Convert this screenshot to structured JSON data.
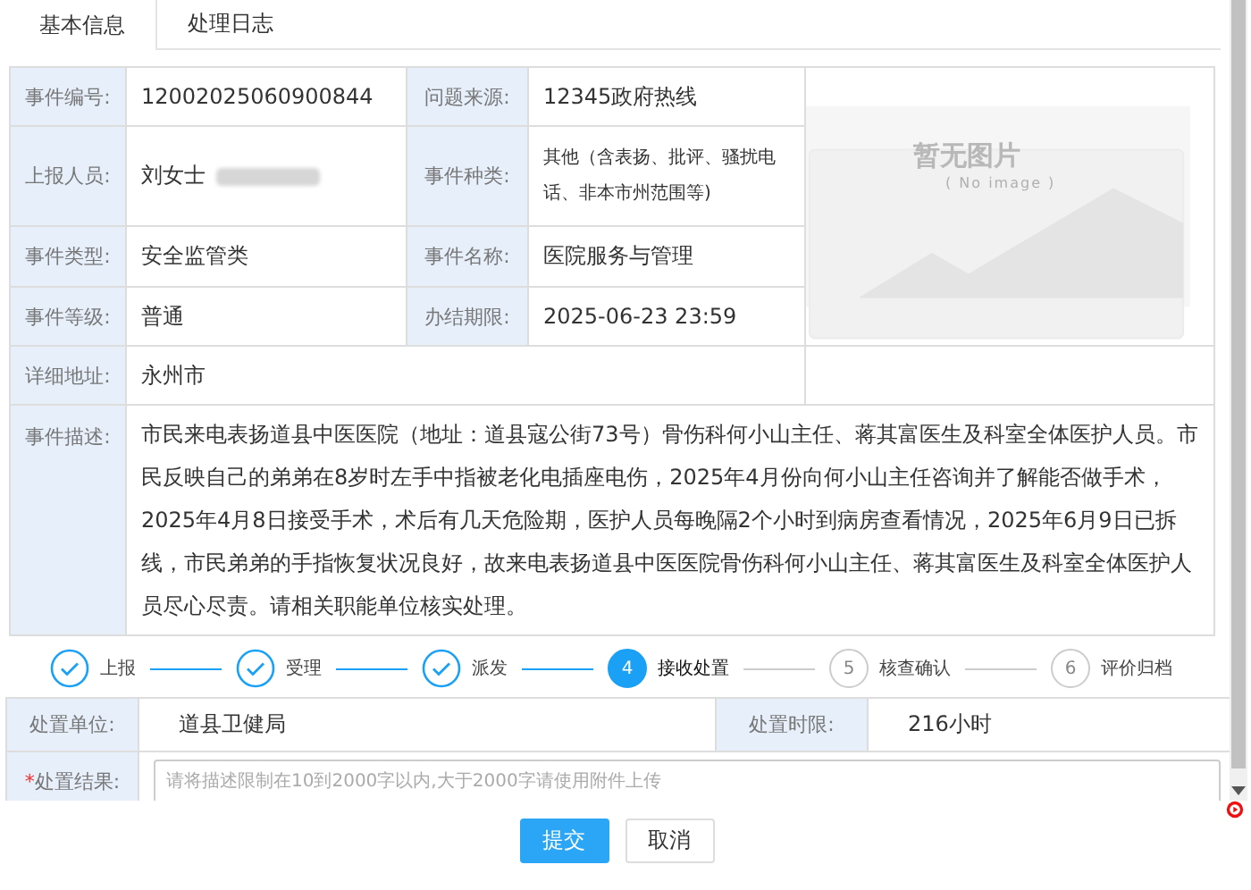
{
  "tabs": [
    {
      "label": "基本信息",
      "selected": true
    },
    {
      "label": "处理日志",
      "selected": false
    }
  ],
  "details": {
    "event_no": {
      "label": "事件编号:",
      "value": "12002025060900844"
    },
    "source": {
      "label": "问题来源:",
      "value": "12345政府热线"
    },
    "reporter": {
      "label": "上报人员:",
      "value": "刘女士"
    },
    "category": {
      "label": "事件种类:",
      "value": "其他（含表扬、批评、骚扰电话、非本市州范围等)"
    },
    "type": {
      "label": "事件类型:",
      "value": "安全监管类"
    },
    "name": {
      "label": "事件名称:",
      "value": "医院服务与管理"
    },
    "level": {
      "label": "事件等级:",
      "value": "普通"
    },
    "deadline": {
      "label": "办结期限:",
      "value": "2025-06-23 23:59"
    },
    "address": {
      "label": "详细地址:",
      "value": "永州市"
    },
    "description": {
      "label": "事件描述:",
      "value": "市民来电表扬道县中医医院（地址：道县寇公街73号）骨伤科何小山主任、蒋其富医生及科室全体医护人员。市民反映自己的弟弟在8岁时左手中指被老化电插座电伤，2025年4月份向何小山主任咨询并了解能否做手术，2025年4月8日接受手术，术后有几天危险期，医护人员每晚隔2个小时到病房查看情况，2025年6月9日已拆线，市民弟弟的手指恢复状况良好，故来电表扬道县中医医院骨伤科何小山主任、蒋其富医生及科室全体医护人员尽心尽责。请相关职能单位核实处理。"
    },
    "image": {
      "title": "暂无图片",
      "subtitle": "( No image )"
    }
  },
  "steps": [
    {
      "label": "上报",
      "done": true,
      "active": false
    },
    {
      "label": "受理",
      "done": true,
      "active": false
    },
    {
      "label": "派发",
      "done": true,
      "active": false
    },
    {
      "number": "4",
      "label": "接收处置",
      "done": false,
      "active": true
    },
    {
      "number": "5",
      "label": "核查确认",
      "done": false,
      "active": false
    },
    {
      "number": "6",
      "label": "评价归档",
      "done": false,
      "active": false
    }
  ],
  "handling": {
    "unit_label": "处置单位:",
    "unit": "道县卫健局",
    "limit_label": "处置时限:",
    "limit": "216小时",
    "result_label": "处置结果:",
    "required_mark": "*",
    "result_placeholder": "请将描述限制在10到2000字以内,大于2000字请使用附件上传"
  },
  "buttons": [
    {
      "label": "提交",
      "kind": "primary"
    },
    {
      "label": "取消",
      "kind": "default"
    }
  ]
}
